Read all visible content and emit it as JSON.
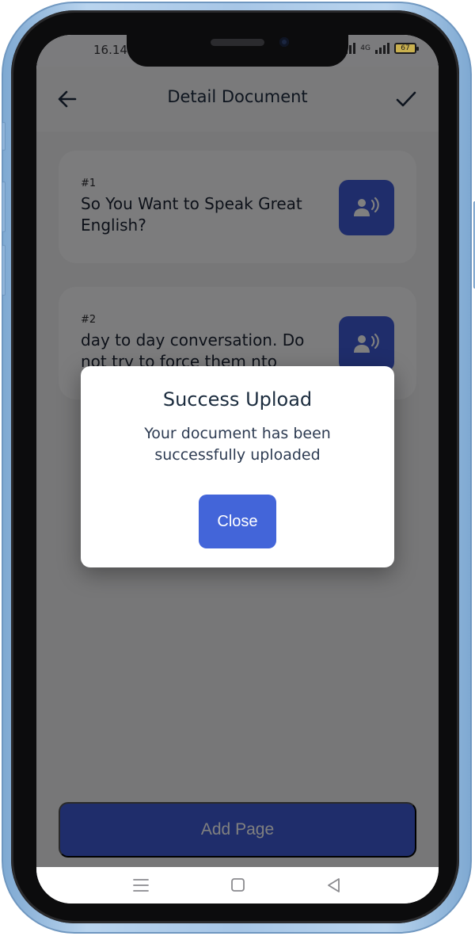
{
  "status_bar": {
    "time": "16.14",
    "network_label": "4G",
    "battery_level": "67"
  },
  "header": {
    "title": "Detail Document",
    "back_icon": "arrow-left-icon",
    "confirm_icon": "check-icon"
  },
  "pages": [
    {
      "number": "#1",
      "text": "So You Want to Speak Great English?",
      "speak_icon": "speaker-person-icon"
    },
    {
      "number": "#2",
      "text": "day to day conversation. Do not try to force them nto",
      "speak_icon": "speaker-person-icon"
    }
  ],
  "add_page_label": "Add Page",
  "dialog": {
    "title": "Success Upload",
    "message": "Your document has been successfully uploaded",
    "close_label": "Close"
  },
  "nav_bar": {
    "menu_icon": "menu-icon",
    "home_icon": "home-square-icon",
    "back_icon": "back-triangle-icon"
  },
  "colors": {
    "accent": "#3e5bd6",
    "dialog_button": "#4365d9",
    "frame": "#a7c6e6"
  }
}
